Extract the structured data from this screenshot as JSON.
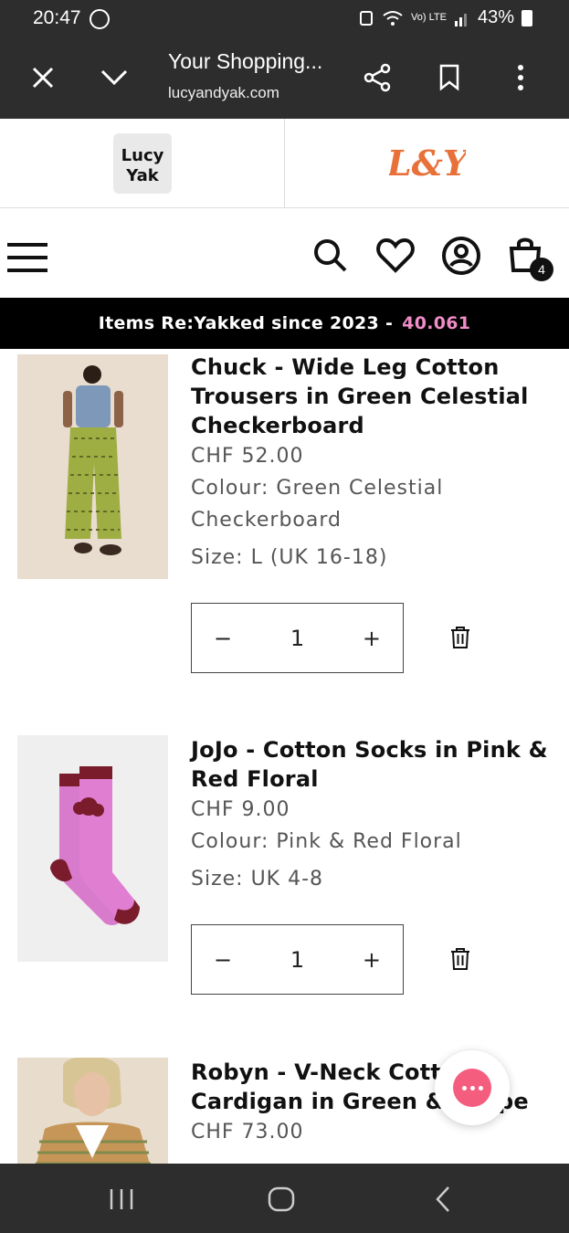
{
  "status": {
    "time": "20:47",
    "battery": "43%",
    "network": "Vo) LTE"
  },
  "browser": {
    "title": "Your Shopping...",
    "url": "lucyandyak.com"
  },
  "logos": {
    "left": "Lucy & Yak",
    "right": "L&Y"
  },
  "header": {
    "cart_count": "4"
  },
  "banner": {
    "label": "Items Re:Yakked since 2023 -",
    "count": "40.061"
  },
  "items": [
    {
      "name": "Chuck - Wide Leg Cotton Trousers in Green Celestial Checkerboard",
      "price": "CHF 52.00",
      "colour": "Colour: Green Celestial Checkerboard",
      "size": "Size: L (UK 16-18)",
      "qty": "1"
    },
    {
      "name": "JoJo - Cotton Socks in Pink & Red Floral",
      "price": "CHF 9.00",
      "colour": "Colour: Pink & Red Floral",
      "size": "Size: UK 4-8",
      "qty": "1"
    },
    {
      "name": "Robyn - V-Neck Cotton Cardigan in Green & Stripe",
      "price": "CHF 73.00"
    }
  ],
  "qty_controls": {
    "minus": "−",
    "plus": "+"
  },
  "colors": {
    "banner_bg": "#000000",
    "banner_accent": "#f08cc6",
    "logo_orange": "#e8713a",
    "chat_pink": "#f55d7f",
    "chrome_bg": "#2d2d2d"
  },
  "icons": [
    "close-icon",
    "chevron-down-icon",
    "share-icon",
    "bookmark-icon",
    "more-icon",
    "menu-icon",
    "search-icon",
    "heart-icon",
    "account-icon",
    "cart-icon",
    "trash-icon",
    "chat-icon"
  ]
}
